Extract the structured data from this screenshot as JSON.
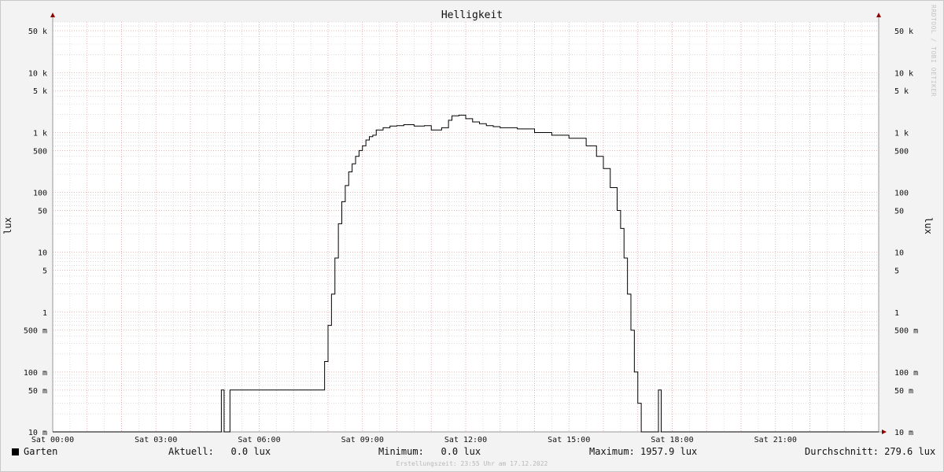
{
  "chart_data": {
    "type": "line",
    "title": "Helligkeit",
    "ylabel_left": "lux",
    "ylabel_right": "lux",
    "y_scale": "log",
    "ylim": [
      0.01,
      70000
    ],
    "xlim_hours": [
      0,
      24
    ],
    "x_tick_hours": [
      0,
      3,
      6,
      9,
      12,
      15,
      18,
      21
    ],
    "x_tick_labels": [
      "Sat 00:00",
      "Sat 03:00",
      "Sat 06:00",
      "Sat 09:00",
      "Sat 12:00",
      "Sat 15:00",
      "Sat 18:00",
      "Sat 21:00"
    ],
    "y_tick_values": [
      0.01,
      0.05,
      0.1,
      0.5,
      1,
      5,
      10,
      50,
      100,
      500,
      1000,
      5000,
      10000,
      50000
    ],
    "y_tick_labels": [
      "10 m",
      "50 m",
      "100 m",
      "500 m",
      "1",
      "5",
      "10",
      "50",
      "100",
      "500",
      "1 k",
      "5 k",
      "10 k",
      "50 k"
    ],
    "grid": true,
    "colors": {
      "line": "#000000",
      "major_grid": "#e8a0a0",
      "minor_grid": "#c8c8c8",
      "axis": "#8b0000",
      "plot_bg": "#ffffff"
    },
    "series": [
      {
        "name": "Garten",
        "x_hours": [
          0,
          4.9,
          4.9,
          4.98,
          4.98,
          5.15,
          5.15,
          7.8,
          7.9,
          8.0,
          8.1,
          8.2,
          8.3,
          8.4,
          8.5,
          8.6,
          8.7,
          8.8,
          8.9,
          9.0,
          9.1,
          9.2,
          9.3,
          9.4,
          9.6,
          9.8,
          10.0,
          10.2,
          10.5,
          10.8,
          11.0,
          11.3,
          11.5,
          11.6,
          11.8,
          12.0,
          12.2,
          12.4,
          12.6,
          12.8,
          13.0,
          13.5,
          14.0,
          14.5,
          15.0,
          15.5,
          15.8,
          16.0,
          16.2,
          16.4,
          16.5,
          16.6,
          16.7,
          16.8,
          16.9,
          17.0,
          17.1,
          17.2,
          17.3,
          17.4,
          17.45,
          17.6,
          17.6,
          17.68,
          17.68,
          24
        ],
        "values": [
          0.01,
          0.01,
          0.05,
          0.05,
          0.01,
          0.01,
          0.05,
          0.05,
          0.15,
          0.6,
          2,
          8,
          30,
          70,
          130,
          220,
          300,
          400,
          500,
          600,
          750,
          850,
          900,
          1100,
          1200,
          1280,
          1300,
          1350,
          1280,
          1300,
          1100,
          1200,
          1600,
          1900,
          1950,
          1700,
          1500,
          1400,
          1300,
          1250,
          1200,
          1150,
          1000,
          900,
          800,
          600,
          400,
          250,
          120,
          50,
          25,
          8,
          2,
          0.5,
          0.1,
          0.03,
          0.01,
          0.01,
          0.01,
          0.01,
          0.01,
          0.01,
          0.05,
          0.05,
          0.01,
          0.01
        ]
      }
    ]
  },
  "legend": {
    "name": "Garten",
    "current": "Aktuell:   0.0 lux",
    "minimum": "Minimum:   0.0 lux",
    "maximum": "Maximum: 1957.9 lux",
    "average": "Durchschnitt: 279.6 lux"
  },
  "footer": "Erstellungszeit: 23:55 Uhr am 17.12.2022",
  "watermark": "RRDTOOL / TOBI OETIKER"
}
